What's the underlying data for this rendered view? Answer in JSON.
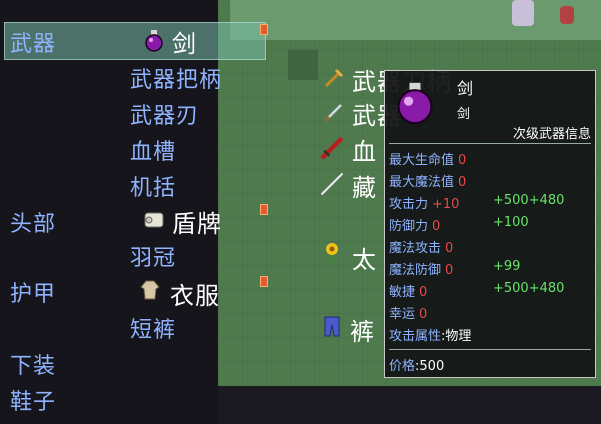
{
  "menu": {
    "categories": [
      "武器",
      "头部",
      "护甲",
      "下装",
      "鞋子"
    ],
    "weapon_subs": [
      "武器把柄",
      "武器刃",
      "血槽",
      "机括"
    ],
    "head_subs": [
      "羽冠"
    ],
    "armor_subs": [
      "短裤"
    ]
  },
  "equipped": {
    "weapon": {
      "name": "剑",
      "icon": "potion-icon"
    },
    "head": {
      "name": "盾牌",
      "icon": "scroll-icon"
    },
    "armor": {
      "name": "衣服",
      "icon": "robe-icon"
    }
  },
  "inventory": {
    "items": [
      {
        "name": "武器刀柄",
        "icon": "sword-hilt-icon"
      },
      {
        "name": "武器刃",
        "icon": "blade-icon"
      },
      {
        "name": "血槽测试品",
        "icon": "red-sword-icon"
      },
      {
        "name": "藏刃",
        "icon": "thin-blade-icon"
      },
      {
        "name": "太阳花",
        "icon": "flower-icon"
      },
      {
        "name": "裤衩",
        "icon": "pants-icon"
      }
    ],
    "visible_text": [
      "武器刀柄",
      "武器",
      "血",
      "藏",
      "太",
      "裤"
    ]
  },
  "tooltip": {
    "name": "剑",
    "subname": "剑",
    "info_title": "次级武器信息",
    "stats": [
      {
        "label": "最大生命值",
        "base": "0",
        "bonus": ""
      },
      {
        "label": "最大魔法值",
        "base": "0",
        "bonus": ""
      },
      {
        "label": "攻击力",
        "base": "+10",
        "bonus": "+500+480"
      },
      {
        "label": "防御力",
        "base": "0",
        "bonus": "+100"
      },
      {
        "label": "魔法攻击",
        "base": "0",
        "bonus": ""
      },
      {
        "label": "魔法防御",
        "base": "0",
        "bonus": "+99"
      },
      {
        "label": "敏捷",
        "base": "0",
        "bonus": "+500+480"
      },
      {
        "label": "幸运",
        "base": "0",
        "bonus": ""
      }
    ],
    "attribute_label": "攻击属性",
    "attribute_value": "物理",
    "price_label": "价格",
    "price_value": "500"
  },
  "colors": {
    "label_blue": "#8fb3ff",
    "stat_red": "#e74a4a",
    "stat_green": "#67e367",
    "selection": "#78beaa"
  }
}
